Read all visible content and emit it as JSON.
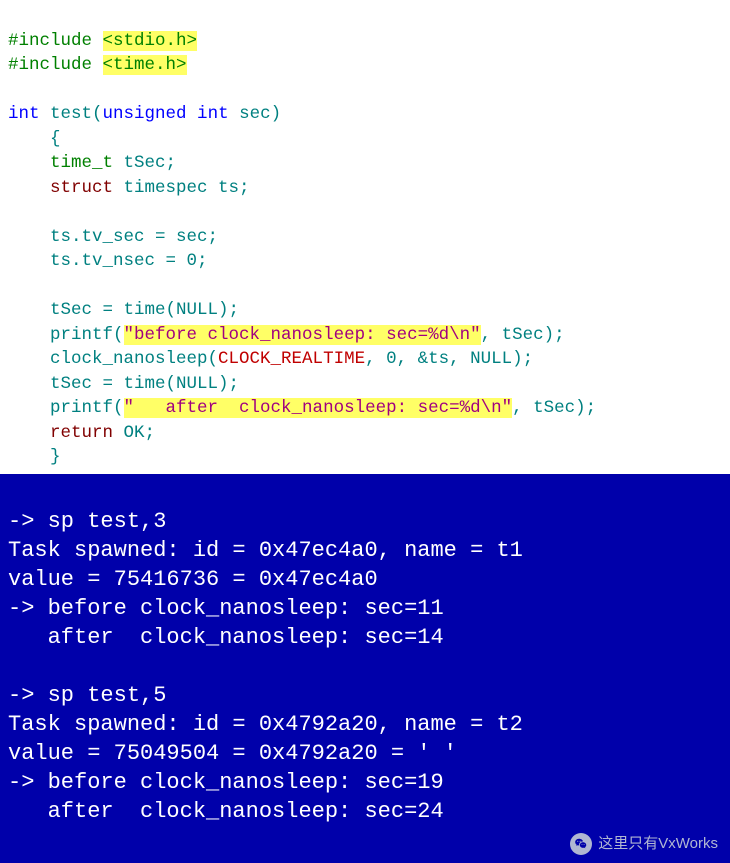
{
  "code": {
    "inc1_pre": "#include ",
    "inc1_hdr": "<stdio.h>",
    "inc2_pre": "#include ",
    "inc2_hdr": "<time.h>",
    "fn_kw_int": "int",
    "fn_name": " test",
    "fn_sig_open": "(",
    "fn_kw_unsigned": "unsigned int",
    "fn_param": " sec",
    "fn_sig_close": ")",
    "brace_open": "    {",
    "decl1_type": "    time_t",
    "decl1_name": " tSec;",
    "decl2_kw": "    struct",
    "decl2_type": " timespec",
    "decl2_name": " ts;",
    "blank1": "",
    "l1": "    ts.tv_sec = sec;",
    "l2_a": "    ts.tv_nsec = ",
    "l2_num": "0",
    "l2_b": ";",
    "blank2": "",
    "l3": "    tSec = time(NULL);",
    "p1_a": "    printf(",
    "p1_str": "\"before clock_nanosleep: sec=%d\\n\"",
    "p1_b": ", tSec);",
    "cn_a": "    clock_nanosleep(",
    "cn_param": "CLOCK_REALTIME",
    "cn_b": ", ",
    "cn_num": "0",
    "cn_c": ", &ts, NULL);",
    "l4": "    tSec = time(NULL);",
    "p2_a": "    printf(",
    "p2_str": "\"   after  clock_nanosleep: sec=%d\\n\"",
    "p2_b": ", tSec);",
    "ret_kw": "    return",
    "ret_val": " OK;",
    "brace_close": "    }"
  },
  "term": {
    "l01": "-> sp test,3",
    "l02": "Task spawned: id = 0x47ec4a0, name = t1",
    "l03": "value = 75416736 = 0x47ec4a0",
    "l04": "-> before clock_nanosleep: sec=11",
    "l05": "   after  clock_nanosleep: sec=14",
    "l06": "",
    "l07": "-> sp test,5",
    "l08": "Task spawned: id = 0x4792a20, name = t2",
    "l09": "value = 75049504 = 0x4792a20 = ' '",
    "l10": "-> before clock_nanosleep: sec=19",
    "l11": "   after  clock_nanosleep: sec=24"
  },
  "watermark": {
    "text": "这里只有VxWorks"
  }
}
